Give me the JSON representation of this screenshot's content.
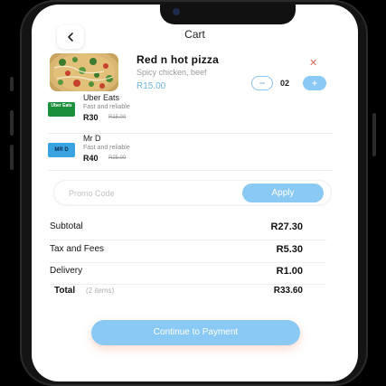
{
  "header": {
    "title": "Cart",
    "back_icon": "chevron-left-icon"
  },
  "cart_item": {
    "name": "Red n hot pizza",
    "description": "Spicy chicken, beef",
    "price": "R15.00",
    "quantity": "02",
    "remove_icon": "close-icon"
  },
  "providers": [
    {
      "logo_text": "Uber Eats",
      "name": "Uber Eats",
      "tagline": "Fast and reliable",
      "price": "R30",
      "old_price": "R15.00"
    },
    {
      "logo_text": "MR D",
      "name": "Mr D",
      "tagline": "Fast and reliable",
      "price": "R40",
      "old_price": "R25.00"
    }
  ],
  "promo": {
    "placeholder": "Promo Code",
    "apply_label": "Apply"
  },
  "summary": {
    "subtotal_label": "Subtotal",
    "subtotal_value": "R27.30",
    "tax_label": "Tax and Fees",
    "tax_value": "R5.30",
    "delivery_label": "Delivery",
    "delivery_value": "R1.00",
    "total_label": "Total",
    "total_count": "(2 items)",
    "total_value": "R33.60"
  },
  "actions": {
    "continue_label": "Continue to Payment"
  },
  "colors": {
    "accent": "#8ac9f4",
    "price_blue": "#6fb4e6",
    "remove_red": "#e06a5a"
  }
}
